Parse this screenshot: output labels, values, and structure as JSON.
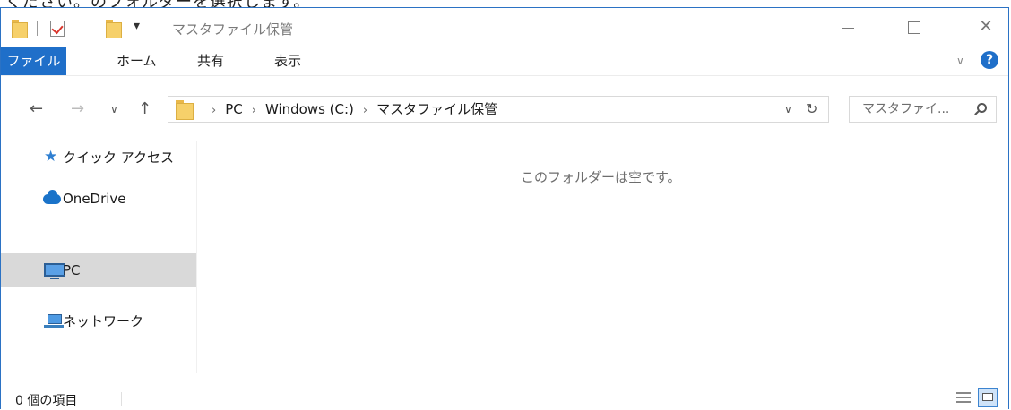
{
  "window": {
    "title": "マスタファイル保管",
    "qat_dropdown": "▾",
    "controls": {
      "minimize": "—",
      "maximize": "□",
      "close": "✕"
    }
  },
  "top_strip_text": "ください。のフォルダーを選択します。",
  "ribbon": {
    "tabs": [
      "ファイル",
      "ホーム",
      "共有",
      "表示"
    ],
    "collapse_glyph": "∨",
    "help_glyph": "?"
  },
  "nav_buttons": {
    "back": "←",
    "forward": "→",
    "recent": "∨",
    "up": "↑"
  },
  "address": {
    "crumbs": [
      "PC",
      "Windows (C:)",
      "マスタファイル保管"
    ],
    "separator": "›",
    "dropdown_glyph": "∨",
    "refresh_glyph": "↻"
  },
  "search": {
    "placeholder": "マスタファイ..."
  },
  "sidebar": {
    "items": [
      {
        "label": "クイック アクセス",
        "icon": "star-icon",
        "selected": false
      },
      {
        "label": "OneDrive",
        "icon": "cloud-icon",
        "selected": false
      },
      {
        "label": "PC",
        "icon": "computer-icon",
        "selected": true
      },
      {
        "label": "ネットワーク",
        "icon": "network-icon",
        "selected": false
      }
    ]
  },
  "content": {
    "empty_message": "このフォルダーは空です。"
  },
  "status": {
    "item_count": "0 個の項目"
  },
  "colors": {
    "accent": "#1f6fc9",
    "selection": "#d9d9d9",
    "folder": "#f6d06a"
  }
}
